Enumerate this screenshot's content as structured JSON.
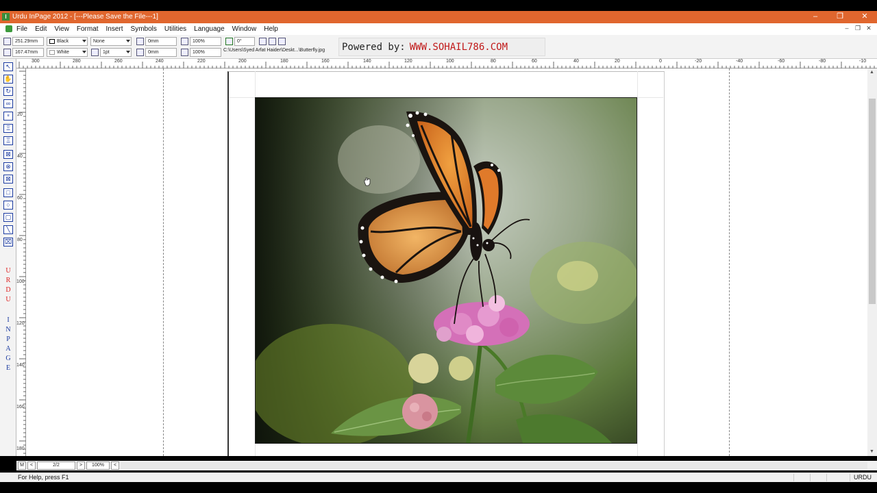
{
  "window": {
    "title": "Urdu InPage 2012 - [---Please Save the File---1]",
    "app_icon_glyph": "I",
    "controls": [
      "–",
      "❐",
      "✕"
    ],
    "accent_color": "#e0662e"
  },
  "menu": {
    "items": [
      "File",
      "Edit",
      "View",
      "Format",
      "Insert",
      "Symbols",
      "Utilities",
      "Language",
      "Window",
      "Help"
    ],
    "mdi_controls": [
      "–",
      "❐",
      "✕"
    ]
  },
  "toolbar": {
    "x_pos": "251.29mm",
    "y_pos": "167.47mm",
    "line_color": "Black",
    "fill_color": "White",
    "line_style": "None",
    "line_weight": "1pt",
    "offset_top": "0mm",
    "offset_bottom": "0mm",
    "scale_x": "100%",
    "scale_y": "100%",
    "rotation": "0°",
    "file_path": "C:\\Users\\Syed  Arfat Haider\\Deskt...\\Butterfly.jpg"
  },
  "watermark": {
    "label": "Powered by:",
    "url": "WWW.SOHAIL786.COM"
  },
  "palette": {
    "tools": [
      "↖",
      "✋",
      "↻",
      "∞",
      "⁸",
      "Ξ",
      "Ξ",
      "⊠",
      "⊗",
      "⊠",
      "□",
      "○",
      "▢",
      "╲",
      "⌧"
    ],
    "urdu_letters": [
      "U",
      "R",
      "D",
      "U"
    ],
    "inpage_letters": [
      "I",
      "N",
      "P",
      "A",
      "G",
      "E"
    ]
  },
  "ruler": {
    "h_labels": [
      "300",
      "280",
      "260",
      "240",
      "220",
      "200",
      "180",
      "160",
      "140",
      "120",
      "100",
      "80",
      "60",
      "40",
      "20",
      "0",
      "-20",
      "-40",
      "-60",
      "-80",
      "-10"
    ],
    "v_labels": [
      "20",
      "40",
      "60",
      "80",
      "100",
      "120",
      "140",
      "160",
      "180"
    ]
  },
  "navigation": {
    "mode_button": "M",
    "prev": "<",
    "page": "2/2",
    "next": ">",
    "zoom": "100%",
    "scroll_left": "<"
  },
  "status": {
    "help_text": "For Help, press F1",
    "language": "URDU"
  }
}
